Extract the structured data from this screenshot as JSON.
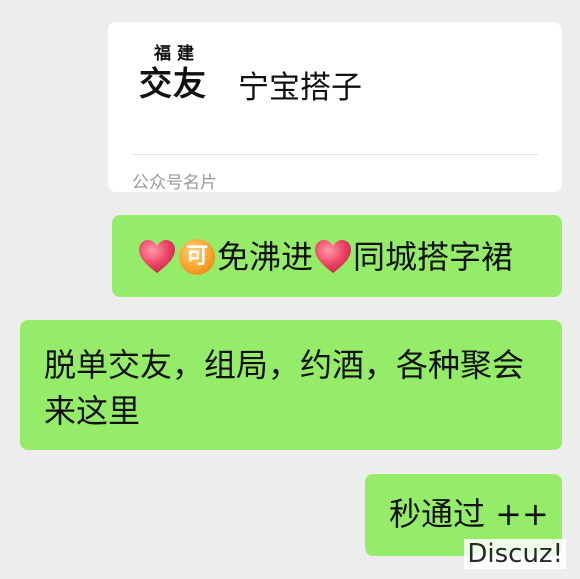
{
  "card": {
    "logo_top": "福建",
    "logo_main": "交友",
    "name": "宁宝搭子",
    "footer": "公众号名片"
  },
  "messages": [
    {
      "icons": [
        "heart-icon",
        "ke-badge-icon",
        "heart-icon"
      ],
      "badge_text": "可",
      "text_a": "免沸进",
      "text_b": "同城搭字裙"
    },
    {
      "text": "脱单交友，组局，约酒，各种聚会来这里"
    },
    {
      "text": "秒通过 ++"
    }
  ],
  "watermark": "Discuz!",
  "colors": {
    "bubble": "#95ec69",
    "background": "#ededed",
    "card": "#ffffff",
    "heart": "#f04a6a"
  }
}
